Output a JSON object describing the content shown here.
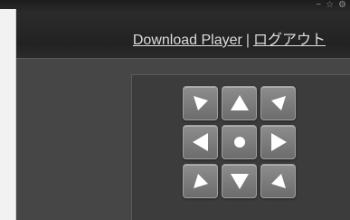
{
  "window_controls": [
    "−",
    "☆",
    "⚙"
  ],
  "header": {
    "download_label": "Download Player",
    "separator": "|",
    "logout_label": "ログアウト"
  },
  "ptz": {
    "buttons": [
      {
        "icon": "arrow-up-left-icon"
      },
      {
        "icon": "arrow-up-icon"
      },
      {
        "icon": "arrow-up-right-icon"
      },
      {
        "icon": "arrow-left-icon"
      },
      {
        "icon": "center-dot-icon"
      },
      {
        "icon": "arrow-right-icon"
      },
      {
        "icon": "arrow-down-left-icon"
      },
      {
        "icon": "arrow-down-icon"
      },
      {
        "icon": "arrow-down-right-icon"
      }
    ]
  }
}
